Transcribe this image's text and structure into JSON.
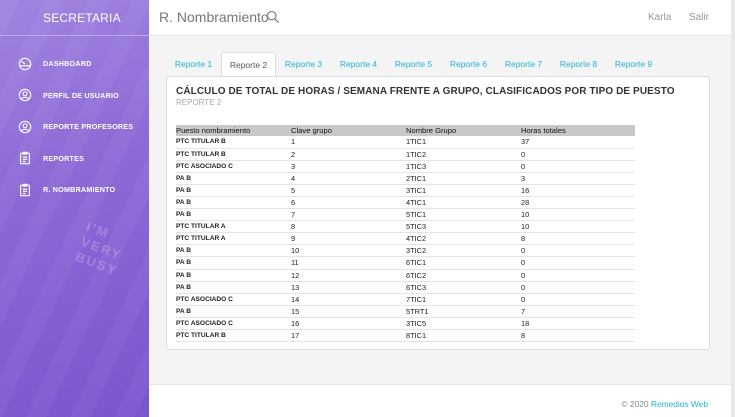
{
  "sidebar": {
    "brand": "SECRETARIA",
    "items": [
      {
        "label": "DASHBOARD",
        "icon": "dashboard-icon"
      },
      {
        "label": "PERFIL DE USUARIO",
        "icon": "user-icon"
      },
      {
        "label": "REPORTE PROFESORES",
        "icon": "user-icon"
      },
      {
        "label": "REPORTES",
        "icon": "clipboard-icon"
      },
      {
        "label": "R. NOMBRAMIENTO",
        "icon": "clipboard-icon"
      }
    ],
    "watermark": "I'M\nVERY\nBUSY"
  },
  "header": {
    "title": "R. Nombramiento",
    "user": "Karla",
    "logout": "Salir"
  },
  "tabs": [
    "Reporte 1",
    "Reporte 2",
    "Reporte 3",
    "Reporte 4",
    "Reporte 5",
    "Reporte 6",
    "Reporte 7",
    "Reporte 8",
    "Reporte 9"
  ],
  "active_tab": "Reporte 2",
  "panel": {
    "title": "CÁLCULO DE TOTAL DE HORAS / SEMANA FRENTE A GRUPO, CLASIFICADOS POR TIPO DE PUESTO",
    "subtitle": "REPORTE 2"
  },
  "table": {
    "headers": [
      "Puesto nombramiento",
      "Clave grupo",
      "Nombre Grupo",
      "Horas totales"
    ],
    "rows": [
      [
        "PTC TITULAR B",
        "1",
        "1TIC1",
        "37"
      ],
      [
        "PTC TITULAR B",
        "2",
        "1TIC2",
        "0"
      ],
      [
        "PTC ASOCIADO C",
        "3",
        "1TIC3",
        "0"
      ],
      [
        "PA B",
        "4",
        "2TIC1",
        "3"
      ],
      [
        "PA B",
        "5",
        "3TIC1",
        "16"
      ],
      [
        "PA B",
        "6",
        "4TIC1",
        "28"
      ],
      [
        "PA B",
        "7",
        "5TIC1",
        "10"
      ],
      [
        "PTC TITULAR A",
        "8",
        "5TIC3",
        "10"
      ],
      [
        "PTC TITULAR A",
        "9",
        "4TIC2",
        "8"
      ],
      [
        "PA B",
        "10",
        "3TIC2",
        "0"
      ],
      [
        "PA B",
        "11",
        "6TIC1",
        "0"
      ],
      [
        "PA B",
        "12",
        "6TIC2",
        "0"
      ],
      [
        "PA B",
        "13",
        "6TIC3",
        "0"
      ],
      [
        "PTC ASOCIADO C",
        "14",
        "7TIC1",
        "0"
      ],
      [
        "PA B",
        "15",
        "5TRT1",
        "7"
      ],
      [
        "PTC ASOCIADO C",
        "16",
        "3TIC5",
        "18"
      ],
      [
        "PTC TITULAR B",
        "17",
        "8TIC1",
        "8"
      ]
    ]
  },
  "footer": {
    "prefix": "© 2020",
    "link": "Remedios Web"
  },
  "colors": {
    "accent": "#24b3d6",
    "sidebar": "#8d6ad6"
  }
}
